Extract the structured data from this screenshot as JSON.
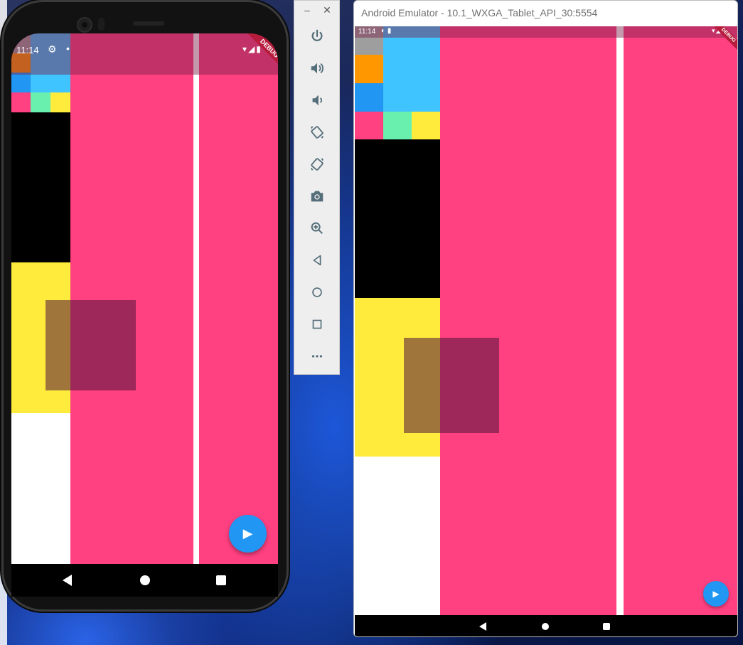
{
  "phone_emulator": {
    "status_bar": {
      "time": "11:14",
      "icons": [
        "settings-icon",
        "dot-icon",
        "wifi-icon",
        "signal-icon",
        "battery-icon"
      ]
    },
    "debug_banner": "DEBUG",
    "fab_icon": "▶",
    "colors": {
      "primary_background": "#ff4081",
      "grey": "#9e9e9e",
      "orange": "#ff9800",
      "sky_blue": "#40c4ff",
      "blue": "#2196f3",
      "green": "#69f0ae",
      "yellow": "#ffeb3b",
      "black": "#000000",
      "white": "#ffffff",
      "fab": "#2196f3"
    }
  },
  "emulator_toolbar": {
    "window_controls": {
      "minimize": "–",
      "close": "✕"
    },
    "buttons": [
      {
        "name": "power-icon",
        "label": "Power"
      },
      {
        "name": "volume-up-icon",
        "label": "Volume up"
      },
      {
        "name": "volume-down-icon",
        "label": "Volume down"
      },
      {
        "name": "rotate-left-icon",
        "label": "Rotate left"
      },
      {
        "name": "rotate-right-icon",
        "label": "Rotate right"
      },
      {
        "name": "camera-icon",
        "label": "Take screenshot"
      },
      {
        "name": "zoom-icon",
        "label": "Zoom"
      },
      {
        "name": "back-icon",
        "label": "Back"
      },
      {
        "name": "home-icon",
        "label": "Home"
      },
      {
        "name": "overview-icon",
        "label": "Overview"
      },
      {
        "name": "more-icon",
        "label": "Extended controls"
      }
    ]
  },
  "tablet_emulator": {
    "window_title": "Android Emulator - 10.1_WXGA_Tablet_API_30:5554",
    "status_bar": {
      "time": "11:14",
      "left_icons": "◐ ▮",
      "right_icons": "▾◢▮"
    },
    "debug_banner": "DEBUG",
    "fab_icon": "▶"
  }
}
